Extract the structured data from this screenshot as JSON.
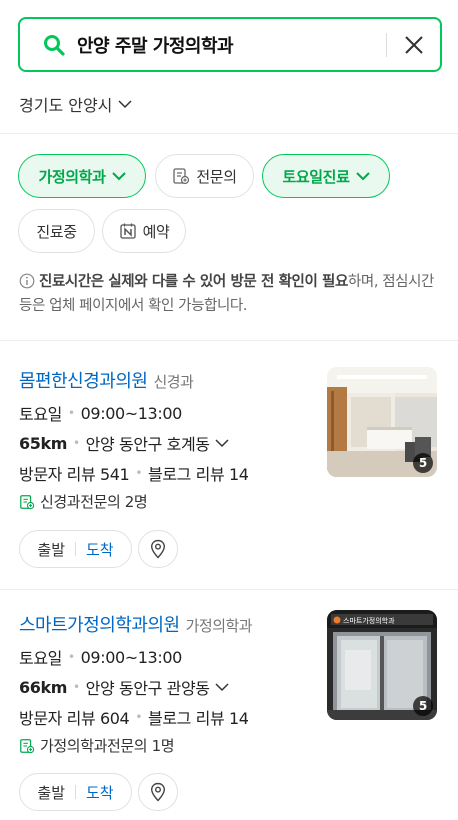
{
  "search": {
    "query": "안양 주말 가정의학과"
  },
  "region": {
    "label": "경기도 안양시"
  },
  "filters": {
    "row1": [
      {
        "label": "가정의학과",
        "active": true,
        "icon": "chevron-down"
      },
      {
        "label": "전문의",
        "active": false,
        "icon": "doctor-badge"
      },
      {
        "label": "토요일진료",
        "active": true,
        "icon": "chevron-down"
      }
    ],
    "row2": [
      {
        "label": "진료중",
        "active": false
      },
      {
        "label": "예약",
        "active": false,
        "icon": "naver-n"
      }
    ]
  },
  "notice": {
    "bold_prefix": "진료시간은 실제와 다를 수 있어 방문 전 확인이 필요",
    "rest": "하며, 점심시간 등은 업체 페이지에서 확인 가능합니다."
  },
  "listings": [
    {
      "name": "몸편한신경과의원",
      "category": "신경과",
      "day": "토요일",
      "hours": "09:00~13:00",
      "distance": "65km",
      "address": "안양 동안구 호계동",
      "visitor_reviews": "방문자 리뷰 541",
      "blog_reviews": "블로그 리뷰 14",
      "specialists": "신경과전문의 2명",
      "photo_count": "5",
      "depart_label": "출발",
      "arrive_label": "도착"
    },
    {
      "name": "스마트가정의학과의원",
      "category": "가정의학과",
      "day": "토요일",
      "hours": "09:00~13:00",
      "distance": "66km",
      "address": "안양 동안구 관양동",
      "visitor_reviews": "방문자 리뷰 604",
      "blog_reviews": "블로그 리뷰 14",
      "specialists": "가정의학과전문의 1명",
      "photo_count": "5",
      "sign_text": "스마트가정의학과",
      "depart_label": "출발",
      "arrive_label": "도착"
    }
  ],
  "colors": {
    "accent": "#03c75a",
    "link": "#0068c3",
    "chip_active_bg": "#e9f9ef"
  }
}
